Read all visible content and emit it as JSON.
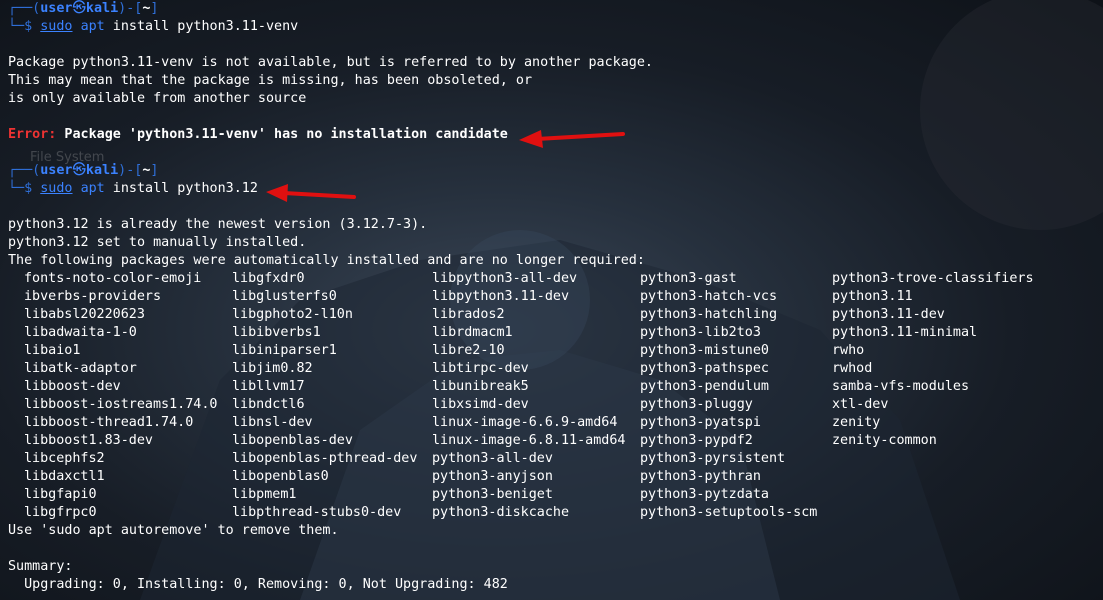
{
  "prompt1": {
    "user": "user",
    "skull": "㉿",
    "host": "kali",
    "dir": "~",
    "sudo": "sudo",
    "apt": "apt",
    "rest": " install python3.11-venv"
  },
  "out1": [
    "Package python3.11-venv is not available, but is referred to by another package.",
    "This may mean that the package is missing, has been obsoleted, or",
    "is only available from another source"
  ],
  "error": {
    "label": "Error:",
    "msg": " Package 'python3.11-venv' has no installation candidate"
  },
  "prompt2": {
    "user": "user",
    "skull": "㉿",
    "host": "kali",
    "dir": "~",
    "sudo": "sudo",
    "apt": "apt",
    "rest": " install python3.12"
  },
  "out2": [
    "python3.12 is already the newest version (3.12.7-3).",
    "python3.12 set to manually installed.",
    "The following packages were automatically installed and are no longer required:"
  ],
  "packages": [
    [
      "fonts-noto-color-emoji",
      "libgfxdr0",
      "libpython3-all-dev",
      "python3-gast",
      "python3-trove-classifiers"
    ],
    [
      "ibverbs-providers",
      "libglusterfs0",
      "libpython3.11-dev",
      "python3-hatch-vcs",
      "python3.11"
    ],
    [
      "libabsl20220623",
      "libgphoto2-l10n",
      "librados2",
      "python3-hatchling",
      "python3.11-dev"
    ],
    [
      "libadwaita-1-0",
      "libibverbs1",
      "librdmacm1",
      "python3-lib2to3",
      "python3.11-minimal"
    ],
    [
      "libaio1",
      "libiniparser1",
      "libre2-10",
      "python3-mistune0",
      "rwho"
    ],
    [
      "libatk-adaptor",
      "libjim0.82",
      "libtirpc-dev",
      "python3-pathspec",
      "rwhod"
    ],
    [
      "libboost-dev",
      "libllvm17",
      "libunibreak5",
      "python3-pendulum",
      "samba-vfs-modules"
    ],
    [
      "libboost-iostreams1.74.0",
      "libndctl6",
      "libxsimd-dev",
      "python3-pluggy",
      "xtl-dev"
    ],
    [
      "libboost-thread1.74.0",
      "libnsl-dev",
      "linux-image-6.6.9-amd64",
      "python3-pyatspi",
      "zenity"
    ],
    [
      "libboost1.83-dev",
      "libopenblas-dev",
      "linux-image-6.8.11-amd64",
      "python3-pypdf2",
      "zenity-common"
    ],
    [
      "libcephfs2",
      "libopenblas-pthread-dev",
      "python3-all-dev",
      "python3-pyrsistent",
      ""
    ],
    [
      "libdaxctl1",
      "libopenblas0",
      "python3-anyjson",
      "python3-pythran",
      ""
    ],
    [
      "libgfapi0",
      "libpmem1",
      "python3-beniget",
      "python3-pytzdata",
      ""
    ],
    [
      "libgfrpc0",
      "libpthread-stubs0-dev",
      "python3-diskcache",
      "python3-setuptools-scm",
      ""
    ]
  ],
  "autoremove": "Use 'sudo apt autoremove' to remove them.",
  "summary": {
    "title": "Summary:",
    "line": "  Upgrading: 0, Installing: 0, Removing: 0, Not Upgrading: 482"
  },
  "desktop_ghost": "File System",
  "colors": {
    "prompt": "#3b82ff",
    "error": "#ee3333",
    "arrow": "#e01010"
  }
}
